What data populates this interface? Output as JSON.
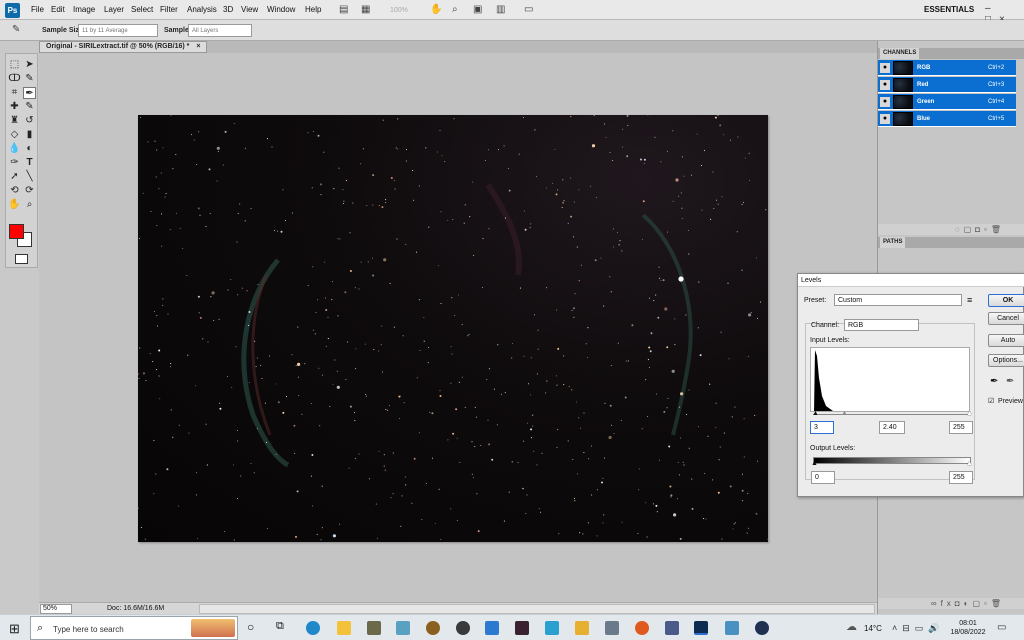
{
  "app": {
    "logo": "Ps",
    "workspace": "ESSENTIALS",
    "window_controls": [
      "–",
      "□",
      "×"
    ]
  },
  "menu": [
    "File",
    "Edit",
    "Image",
    "Layer",
    "Select",
    "Filter",
    "Analysis",
    "3D",
    "View",
    "Window",
    "Help"
  ],
  "menubar_zoom": "100%",
  "options": {
    "sample_size_label": "Sample Size:",
    "sample_size_value": "11 by 11 Average",
    "sample_label": "Sample:",
    "sample_value": "All Layers"
  },
  "document": {
    "tab_title": "Original - SIRILextract.tif @ 50% (RGB/16) *",
    "close": "×"
  },
  "status": {
    "zoom": "50%",
    "doc_size": "Doc: 16.6M/16.6M"
  },
  "panels": {
    "channels_title": "CHANNELS",
    "channels": [
      {
        "name": "RGB",
        "shortcut": "Ctrl+2"
      },
      {
        "name": "Red",
        "shortcut": "Ctrl+3"
      },
      {
        "name": "Green",
        "shortcut": "Ctrl+4"
      },
      {
        "name": "Blue",
        "shortcut": "Ctrl+5"
      }
    ],
    "paths_title": "PATHS"
  },
  "levels": {
    "title": "Levels",
    "preset_label": "Preset:",
    "preset_value": "Custom",
    "channel_label": "Channel:",
    "channel_value": "RGB",
    "input_levels_label": "Input Levels:",
    "input_black": "3",
    "input_gamma": "2.40",
    "input_white": "255",
    "output_levels_label": "Output Levels:",
    "output_black": "0",
    "output_white": "255",
    "ok": "OK",
    "cancel": "Cancel",
    "auto": "Auto",
    "options": "Options...",
    "preview_label": "Preview",
    "preview_checked": true
  },
  "taskbar": {
    "search_placeholder": "Type here to search",
    "weather": "14°C",
    "time": "08:01",
    "date": "18/08/2022"
  },
  "colors": {
    "foreground": "#ff0000",
    "background": "#ffffff",
    "selection": "#0a6fd0"
  }
}
